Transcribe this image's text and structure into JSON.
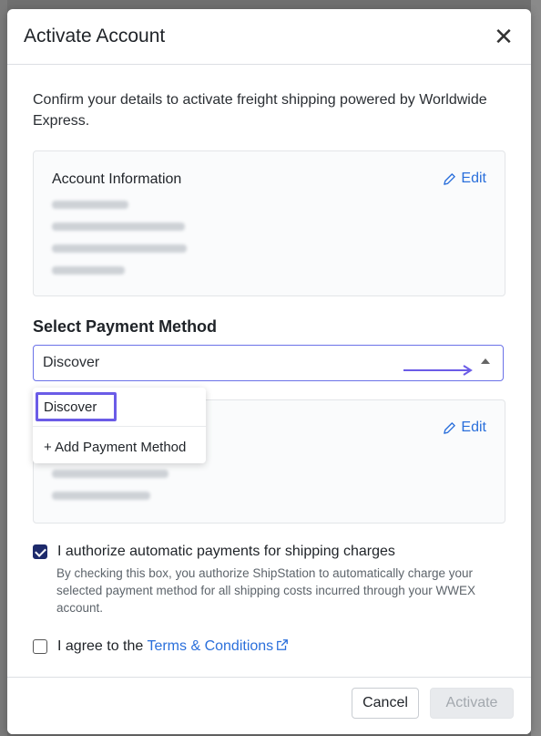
{
  "modal": {
    "title": "Activate Account",
    "close_label": "✕",
    "intro": "Confirm your details to activate freight shipping powered by Worldwide Express."
  },
  "account_card": {
    "title": "Account Information",
    "edit_label": "Edit"
  },
  "payment_section": {
    "label": "Select Payment Method",
    "selected_value": "Discover",
    "edit_label": "Edit",
    "options": [
      {
        "label": "Discover"
      },
      {
        "label": "+ Add Payment Method"
      }
    ]
  },
  "authorize": {
    "checked": true,
    "label": "I authorize automatic payments for shipping charges",
    "help": "By checking this box, you authorize ShipStation to automatically charge your selected payment method for all shipping costs incurred through your WWEX account."
  },
  "terms": {
    "checked": false,
    "prefix": "I agree to the ",
    "link_label": "Terms & Conditions"
  },
  "footer": {
    "cancel_label": "Cancel",
    "activate_label": "Activate"
  },
  "colors": {
    "accent": "#2a6fdb",
    "checkbox": "#1d2a6b",
    "highlight": "#6b5ce7"
  }
}
